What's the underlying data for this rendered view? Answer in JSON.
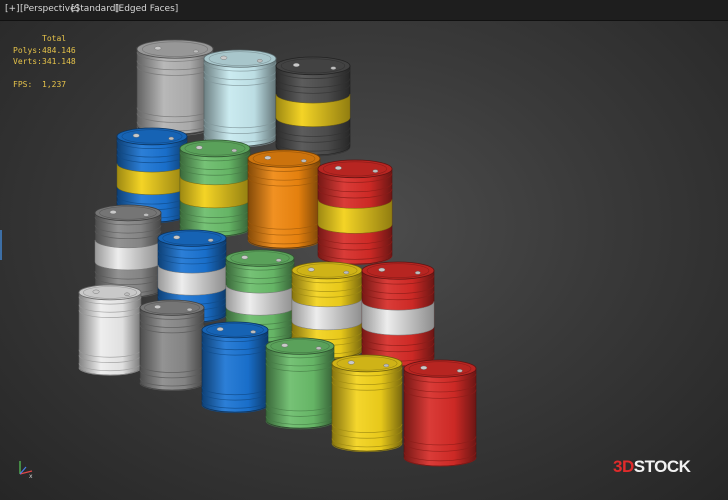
{
  "viewport": {
    "menu_plus": "[+]",
    "view_mode": "[Perspective]",
    "shading": "[Standard]",
    "display": "[Edged Faces]"
  },
  "stats": {
    "header": "Total",
    "polys_label": "Polys:",
    "polys_value": "484.146",
    "verts_label": "Verts:",
    "verts_value": "341.148",
    "fps_label": "FPS:",
    "fps_value": "1,237"
  },
  "brand": {
    "text_a": "3D",
    "text_b": "STOCK"
  },
  "colors": {
    "white": "#ececec",
    "lightgray": "#b2b2b2",
    "gray": "#8a8a8a",
    "cyan": "#c6e9ef",
    "charcoal": "#4e4e4e",
    "yellow": "#f3d21b",
    "blue": "#1a74d4",
    "green": "#6abd6a",
    "orange": "#f0870f",
    "red": "#d72b27"
  },
  "barrels": [
    {
      "color": "lightgray",
      "band": null
    },
    {
      "color": "cyan",
      "band": null
    },
    {
      "color": "charcoal",
      "band": "yellow"
    },
    {
      "color": "blue",
      "band": "yellow"
    },
    {
      "color": "green",
      "band": "yellow"
    },
    {
      "color": "orange",
      "band": null
    },
    {
      "color": "red",
      "band": "yellow"
    },
    {
      "color": "gray",
      "band": "white"
    },
    {
      "color": "blue",
      "band": "white"
    },
    {
      "color": "green",
      "band": "white"
    },
    {
      "color": "yellow",
      "band": "white"
    },
    {
      "color": "red",
      "band": "white"
    },
    {
      "color": "white",
      "band": null
    },
    {
      "color": "gray",
      "band": null
    },
    {
      "color": "blue",
      "band": null
    },
    {
      "color": "green",
      "band": null
    },
    {
      "color": "yellow",
      "band": null
    },
    {
      "color": "red",
      "band": null
    }
  ]
}
